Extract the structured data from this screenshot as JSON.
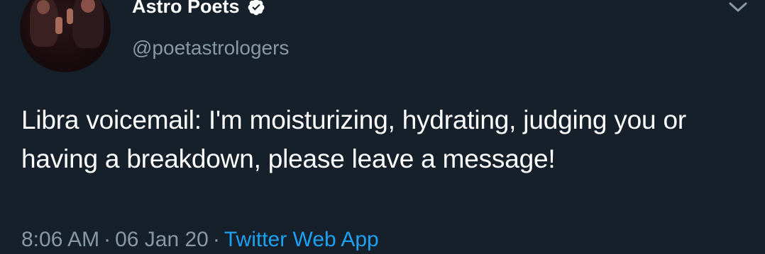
{
  "author": {
    "display_name": "Astro Poets",
    "handle": "@poetastrologers",
    "verified": true,
    "avatar_icon": "profile-photo"
  },
  "tweet": {
    "text": "Libra voicemail: I'm moisturizing, hydrating, judging you or having a breakdown, please leave a message!",
    "time": "8:06 AM",
    "date": "06 Jan 20",
    "separator": "·",
    "source": "Twitter Web App"
  },
  "icons": {
    "verified": "verified-badge-icon",
    "menu": "chevron-down-icon"
  },
  "colors": {
    "background": "#15202b",
    "text_primary": "#ffffff",
    "text_secondary": "#8899a6",
    "link": "#1da1f2"
  }
}
